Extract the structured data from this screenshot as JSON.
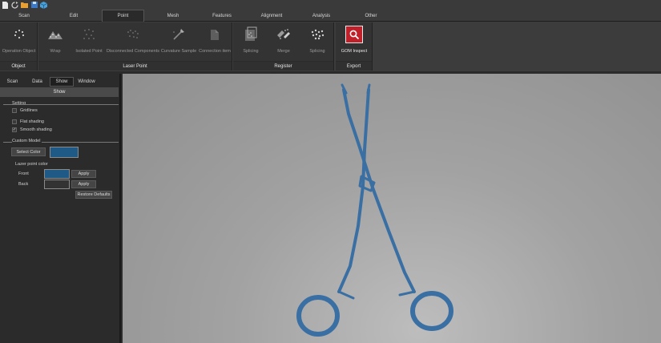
{
  "menu": {
    "tabs": [
      "Scan",
      "Edit",
      "Point",
      "Mesh",
      "Features",
      "Alignment",
      "Analysis",
      "Other"
    ],
    "active": "Point"
  },
  "ribbon": {
    "object_group": {
      "label": "Object",
      "tools": [
        "Operation Object"
      ]
    },
    "laser_group": {
      "label": "Laser Point",
      "tools": [
        "Wrap",
        "Isolated Point",
        "Disconnected Components",
        "Curvature Sample",
        "Connection item"
      ]
    },
    "register_group": {
      "label": "Register",
      "tools": [
        "Splicing",
        "Merge",
        "Splicing"
      ]
    },
    "export_group": {
      "label": "Export",
      "tools": [
        "GOM Inspect"
      ]
    }
  },
  "panel": {
    "tabs": [
      "Scan",
      "Data",
      "Show",
      "Window"
    ],
    "active_tab": "Show",
    "header": "Show",
    "setting": {
      "title": "Setting",
      "gridlines": {
        "label": "Gridlines",
        "checked": false
      },
      "flat_shading": {
        "label": "Flat shading",
        "checked": false
      },
      "smooth_shading": {
        "label": "Smooth shading",
        "checked": true
      }
    },
    "custom_model": {
      "title": "Custom Model",
      "select_color_label": "Select Color",
      "model_color": "#1f5a86"
    },
    "lazer": {
      "title": "Lazer point color",
      "front_label": "Front",
      "front_color": "#1f5a86",
      "back_label": "Back",
      "back_color": "#333333",
      "apply_label": "Apply",
      "restore_label": "Restore Defaults"
    }
  },
  "colors": {
    "accent_red": "#c0202a",
    "model_blue": "#3a6fa3"
  },
  "check_mark": "✓"
}
